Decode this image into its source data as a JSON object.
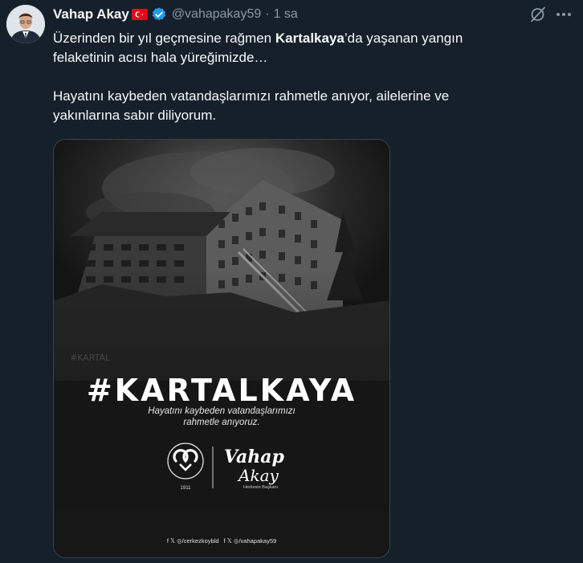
{
  "author": {
    "name": "Vahap Akay",
    "handle": "@vahapakay59",
    "separator": "·",
    "time": "1 sa"
  },
  "icons": {
    "flag": "turkey-flag-icon",
    "verified": "verified-badge-icon",
    "grok": "grok-icon",
    "more": "more-icon"
  },
  "tweet": {
    "line1_pre": "Üzerinden bir yıl geçmesine rağmen ",
    "line1_bold": "Kartalkaya",
    "line1_post": "’da yaşanan yangın",
    "line2": "felaketinin acısı hala yüreğimizde…",
    "line3": "Hayatını kaybeden vatandaşlarımızı rahmetle anıyor, ailelerine ve",
    "line4": "yakınlarına sabır diliyorum."
  },
  "poster": {
    "hashtag": "#KARTALKAYA",
    "subtitle_line1": "Hayatını kaybeden vatandaşlarımızı",
    "subtitle_line2": "rahmetle anıyoruz.",
    "municipality_year": "1911",
    "signature_line1": "Vahap",
    "signature_line2": "Akay",
    "signature_caption": "Herkesin Başkanı",
    "social_left": "f 𝕏 ◎/cerkezkoybld",
    "social_right": "f 𝕏 ◎/vahapakay59"
  },
  "colors": {
    "background": "#15202b",
    "text": "#f7f9f9",
    "muted": "#8b98a5",
    "verified": "#1d9bf0",
    "flag_red": "#e30a17",
    "media_border": "#38444d"
  }
}
